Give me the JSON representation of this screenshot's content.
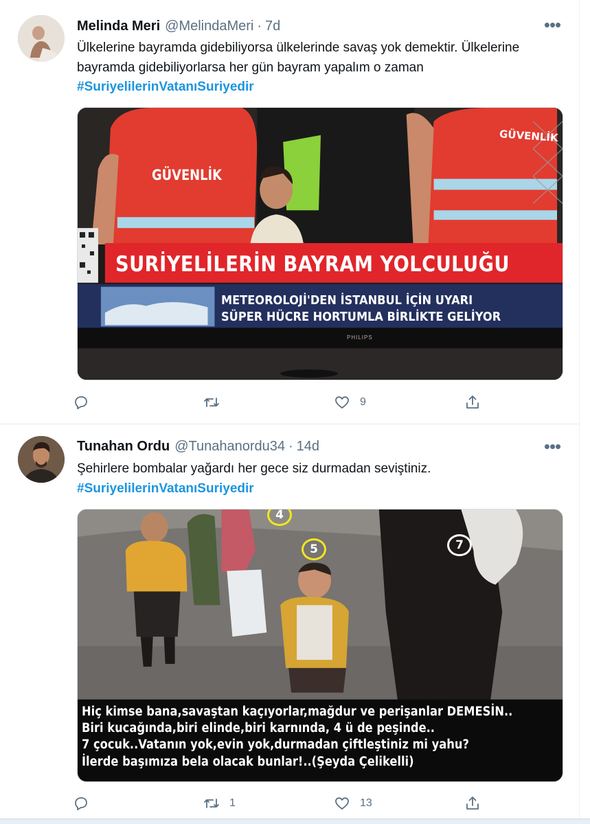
{
  "tweets": [
    {
      "author": {
        "display_name": "Melinda Meri",
        "handle": "@MelindaMeri",
        "avatar_icon": "user-avatar"
      },
      "separator": "·",
      "time": "7d",
      "more_icon": "more-horizontal-icon",
      "more_label": "•••",
      "text": "Ülkelerine bayramda gidebiliyorsa ülkelerinde savaş yok demektir. Ülkelerine bayramda gidebiliyorlarsa  her gün bayram yapalım o zaman",
      "hashtag": "#SuriyelilerinVatanıSuriyedir",
      "media": {
        "headline": "SURİYELİLERİN BAYRAM YOLCULUĞU",
        "ticker_line_1": "METEOROLOJİ'DEN İSTANBUL İÇİN UYARI",
        "ticker_line_2": "SÜPER HÜCRE HORTUMLA BİRLİKTE GELİYOR",
        "vest_left": "GÜVENLİK",
        "vest_right": "GÜVENLİK",
        "tv_brand": "PHILIPS"
      },
      "actions": {
        "reply": {
          "icon": "reply-icon",
          "count": ""
        },
        "retweet": {
          "icon": "retweet-icon",
          "count": ""
        },
        "like": {
          "icon": "heart-icon",
          "count": "9"
        },
        "share": {
          "icon": "share-icon",
          "count": ""
        }
      }
    },
    {
      "author": {
        "display_name": "Tunahan Ordu",
        "handle": "@Tunahanordu34",
        "avatar_icon": "user-avatar"
      },
      "separator": "·",
      "time": "14d",
      "more_icon": "more-horizontal-icon",
      "more_label": "•••",
      "text": "Şehirlere bombalar yağardı her gece siz durmadan seviştiniz.",
      "hashtag": "#SuriyelilerinVatanıSuriyedir",
      "media": {
        "caption_1": "Hiç kimse bana,savaştan kaçıyorlar,mağdur ve perişanlar DEMESİN..",
        "caption_2": "Biri kucağında,biri elinde,biri karnında, 4 ü de peşinde..",
        "caption_3": "7 çocuk..Vatanın yok,evin yok,durmadan çiftleştiniz mi yahu?",
        "caption_4": "İlerde başımıza bela olacak bunlar!..(Şeyda Çelikelli)",
        "badge_4": "4",
        "badge_5": "5",
        "badge_7": "7"
      },
      "actions": {
        "reply": {
          "icon": "reply-icon",
          "count": ""
        },
        "retweet": {
          "icon": "retweet-icon",
          "count": "1"
        },
        "like": {
          "icon": "heart-icon",
          "count": "13"
        },
        "share": {
          "icon": "share-icon",
          "count": ""
        }
      }
    }
  ],
  "colors": {
    "text_primary": "#0f1419",
    "text_secondary": "#5b7083",
    "hashtag": "#1b95e0",
    "divider": "#e3e8ec",
    "banner_red": "#e0262b",
    "ticker_navy": "#23305e"
  }
}
